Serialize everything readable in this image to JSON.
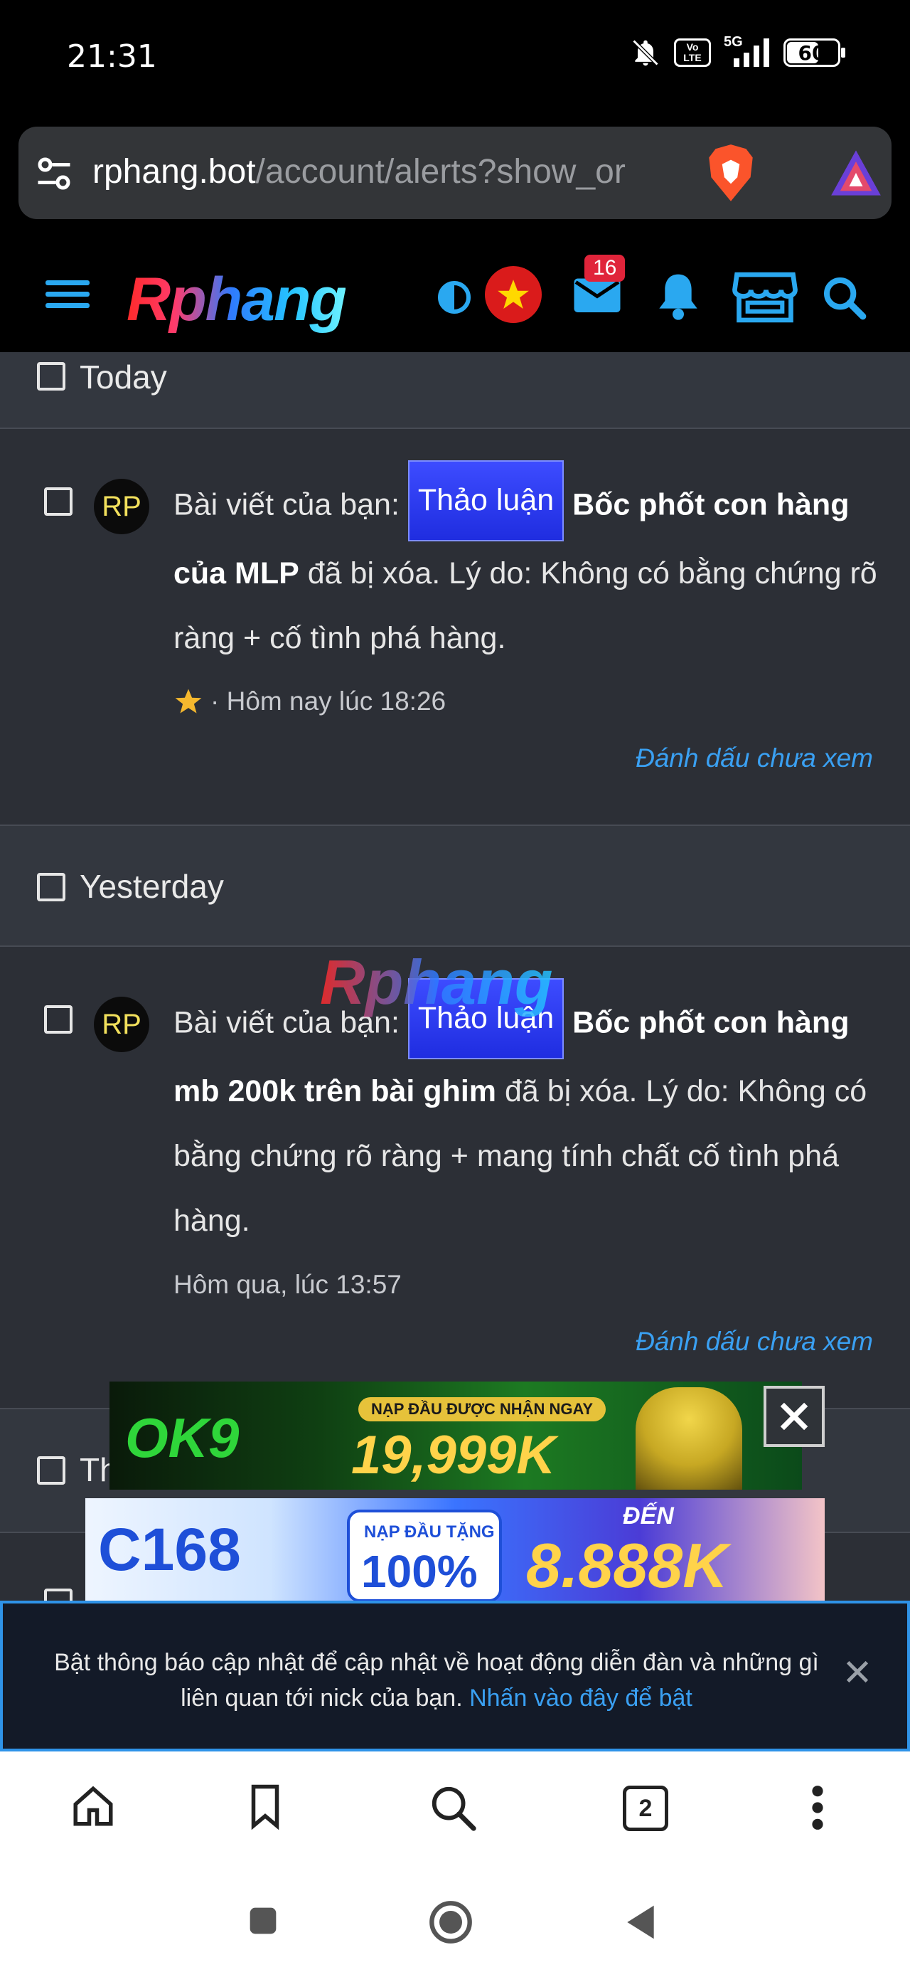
{
  "status_bar": {
    "time": "21:31",
    "network_label": "5G",
    "volte_label": "Vo LTE",
    "battery": "60"
  },
  "url_bar": {
    "host": "rphang.bot",
    "path": "/account/alerts?show_or"
  },
  "forum_header": {
    "logo_text": "Rphang",
    "mail_badge": "16"
  },
  "alerts": {
    "groups": [
      {
        "label": "Today",
        "items": [
          {
            "avatar": "RP",
            "text_before": "Bài viết của bạn:",
            "prefix": "Thảo luận",
            "title_line1": "Bốc phốt con hàng",
            "title_line2": "của MLP",
            "reason": "đã bị xóa. Lý do: Không có bằng chứng rõ ràng + cố tình phá hàng.",
            "meta": "· Hôm nay lúc 18:26",
            "mark_unread": "Đánh dấu chưa xem"
          }
        ]
      },
      {
        "label": "Yesterday",
        "items": [
          {
            "avatar": "RP",
            "text_before": "Bài viết của bạn:",
            "prefix": "Thảo luận",
            "title_line1": "Bốc phốt con hàng",
            "title_line2": "mb 200k trên bài ghim",
            "reason": "đã bị xóa. Lý do: Không có bằng chứng rõ ràng + mang tính chất cố tình phá hàng.",
            "meta": "Hôm qua, lúc 13:57",
            "mark_unread": "Đánh dấu chưa xem"
          }
        ]
      },
      {
        "label": "Th"
      }
    ]
  },
  "watermark": "Rphang",
  "ads": {
    "ad1": {
      "brand": "OK9",
      "sub": "NẠP ĐẦU ĐƯỢC NHẬN NGAY",
      "amount": "19,999K"
    },
    "ad2": {
      "brand": "C168",
      "box_top": "NẠP ĐẦU TẶNG",
      "box_value": "100%",
      "den": "ĐẾN",
      "amount": "8.888K"
    }
  },
  "push_banner": {
    "text": "Bật thông báo cập nhật để cập nhật về hoạt động diễn đàn và những gì liên quan tới nick của bạn.",
    "link": "Nhấn vào đây để bật"
  },
  "toolbar": {
    "tab_count": "2"
  },
  "colors": {
    "accent_link": "#3aa0f2",
    "header_icons": "#2aa8f0",
    "prefix_bg": "#2434e8"
  }
}
